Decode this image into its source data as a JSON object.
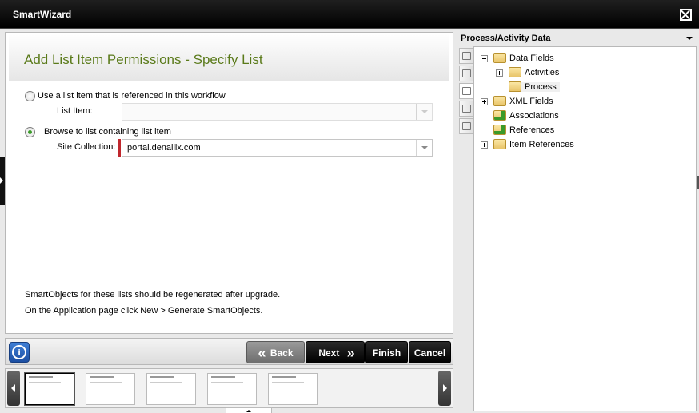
{
  "window": {
    "title": "SmartWizard"
  },
  "wizard": {
    "heading": "Add List Item Permissions - Specify List",
    "option_referenced_label": "Use a list item that is referenced in this workflow",
    "list_item_label": "List Item:",
    "list_item_value": "",
    "option_browse_label": "Browse to list containing list item",
    "site_collection_label": "Site Collection:",
    "site_collection_value": "portal.denallix.com",
    "note_line1": "SmartObjects for these lists should be regenerated after upgrade.",
    "note_line2": "On the Application page click New > Generate SmartObjects."
  },
  "nav": {
    "info_label": "i",
    "back_label": "Back",
    "next_label": "Next",
    "finish_label": "Finish",
    "cancel_label": "Cancel",
    "back_chevron": "«",
    "next_chevron": "»"
  },
  "thumbnails": {
    "count": 5,
    "active_index": 0
  },
  "panel": {
    "title": "Process/Activity Data",
    "tree": [
      {
        "label": "Data Fields",
        "expanded": true,
        "icon": "folder-icon"
      },
      {
        "label": "Activities",
        "expanded": false,
        "icon": "folder-icon"
      },
      {
        "label": "Process",
        "icon": "folder-icon",
        "selected": true
      },
      {
        "label": "XML Fields",
        "expanded": false,
        "icon": "xml-folder-icon"
      },
      {
        "label": "Associations",
        "icon": "association-folder-icon"
      },
      {
        "label": "References",
        "icon": "reference-folder-icon"
      },
      {
        "label": "Item References",
        "expanded": false,
        "icon": "item-reference-icon"
      }
    ]
  },
  "colors": {
    "heading": "#5a7a1a",
    "required": "#c0272d",
    "titlebar": "#000000"
  }
}
